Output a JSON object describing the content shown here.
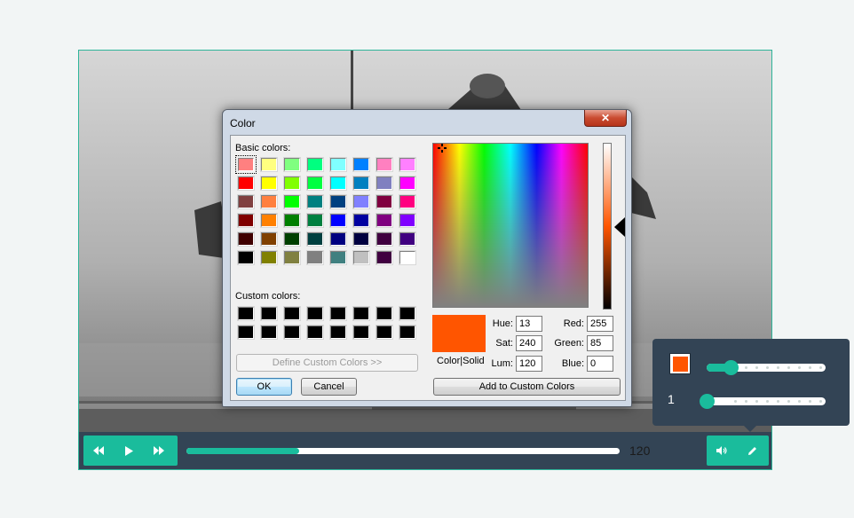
{
  "video": {
    "controls": {
      "rewind_icon": "rewind-icon",
      "play_icon": "play-icon",
      "forward_icon": "fast-forward-icon",
      "volume_icon": "volume-icon",
      "pen_icon": "pencil-icon",
      "progress": 0.26,
      "time": "120"
    }
  },
  "dialog": {
    "title": "Color",
    "close_icon": "close-icon",
    "basic_label": "Basic colors:",
    "custom_label": "Custom colors:",
    "basic_colors": [
      "#ff8080",
      "#ffff80",
      "#80ff80",
      "#00ff80",
      "#80ffff",
      "#0080ff",
      "#ff80c0",
      "#ff80ff",
      "#ff0000",
      "#ffff00",
      "#80ff00",
      "#00ff40",
      "#00ffff",
      "#0080c0",
      "#8080c0",
      "#ff00ff",
      "#804040",
      "#ff8040",
      "#00ff00",
      "#008080",
      "#004080",
      "#8080ff",
      "#800040",
      "#ff0080",
      "#800000",
      "#ff8000",
      "#008000",
      "#008040",
      "#0000ff",
      "#0000a0",
      "#800080",
      "#8000ff",
      "#400000",
      "#804000",
      "#004000",
      "#004040",
      "#000080",
      "#000040",
      "#400040",
      "#400080",
      "#000000",
      "#808000",
      "#808040",
      "#808080",
      "#408080",
      "#c0c0c0",
      "#400040",
      "#ffffff"
    ],
    "selected_basic_index": 0,
    "custom_colors": [
      "#000000",
      "#000000",
      "#000000",
      "#000000",
      "#000000",
      "#000000",
      "#000000",
      "#000000",
      "#000000",
      "#000000",
      "#000000",
      "#000000",
      "#000000",
      "#000000",
      "#000000",
      "#000000"
    ],
    "define_button": "Define Custom Colors >>",
    "ok_button": "OK",
    "cancel_button": "Cancel",
    "preview_color": "#ff5500",
    "preview_label": "Color|Solid",
    "hue_label": "Hue:",
    "hue": "13",
    "sat_label": "Sat:",
    "sat": "240",
    "lum_label": "Lum:",
    "lum": "120",
    "red_label": "Red:",
    "red": "255",
    "green_label": "Green:",
    "green": "85",
    "blue_label": "Blue:",
    "blue": "0",
    "add_custom_button": "Add to Custom Colors"
  },
  "panel": {
    "color": "#ff5500",
    "opacity_level": 0.2,
    "size_value": "1",
    "size_level": 0.0
  },
  "colors": {
    "accent": "#1abc9c",
    "bar": "#334455"
  }
}
